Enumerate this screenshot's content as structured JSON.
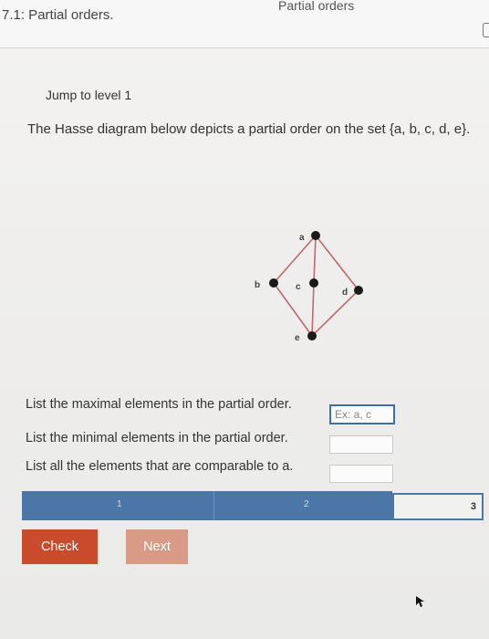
{
  "header": {
    "section_label": "7.1: Partial orders.",
    "page_title": "Partial orders"
  },
  "activity": {
    "jump_link": "Jump to level 1",
    "prompt": "The Hasse diagram below depicts a partial order on the set {a, b, c, d, e}."
  },
  "hasse": {
    "nodes": [
      "a",
      "b",
      "c",
      "d",
      "e"
    ],
    "edges": [
      [
        "e",
        "b"
      ],
      [
        "e",
        "c"
      ],
      [
        "e",
        "d"
      ],
      [
        "b",
        "a"
      ],
      [
        "c",
        "a"
      ],
      [
        "d",
        "a"
      ]
    ],
    "line_color": "#c06a6a",
    "node_color": "#1a1a1a"
  },
  "questions": [
    {
      "text": "List the maximal elements in the partial order.",
      "value": "",
      "placeholder": "Ex: a, c"
    },
    {
      "text": "List the minimal elements in the partial order.",
      "value": "",
      "placeholder": ""
    },
    {
      "text": "List all the elements that are comparable to a.",
      "value": "",
      "placeholder": ""
    }
  ],
  "progress": {
    "segments": [
      "1",
      "2",
      "3"
    ],
    "current_level": 3,
    "fill_color": "#4d76a8"
  },
  "buttons": {
    "check": "Check",
    "next": "Next"
  },
  "colors": {
    "check_button": "#c94b2b",
    "next_button": "#d99a86"
  }
}
